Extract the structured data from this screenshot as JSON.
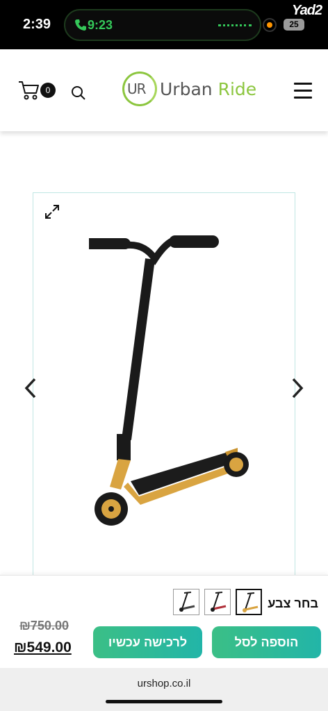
{
  "status_bar": {
    "time": "2:39",
    "call_time": "9:23",
    "battery": "25",
    "app_badge": "Yad2"
  },
  "header": {
    "cart_count": "0",
    "logo_mark": "UR",
    "logo_word_1": "Urban",
    "logo_word_2": "Ride",
    "icons": [
      "cart-icon",
      "search-icon",
      "menu-icon"
    ]
  },
  "gallery": {
    "icons": [
      "expand-icon",
      "chevron-left-icon",
      "chevron-right-icon"
    ],
    "product_colors": {
      "deck": "#d9a441",
      "bar": "#1a1a1a"
    }
  },
  "purchase": {
    "color_label": "בחר צבע",
    "old_price": "₪750.00",
    "new_price": "₪549.00",
    "buy_now_label": "לרכישה עכשיו",
    "add_to_cart_label": "הוספה לסל",
    "accent": "#2bb99a"
  },
  "browser": {
    "url": "urshop.co.il"
  }
}
